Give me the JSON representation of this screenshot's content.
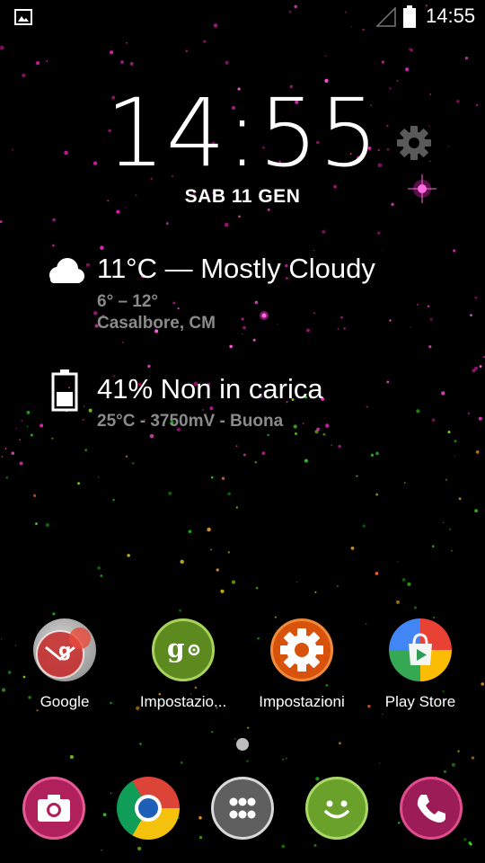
{
  "status_bar": {
    "time": "14:55",
    "icons": [
      "image-icon",
      "signal-icon",
      "battery-icon"
    ]
  },
  "lockscreen": {
    "clock": "14:55",
    "date": "SAB 11 GEN",
    "settings_icon": "gear-icon"
  },
  "weather": {
    "icon": "cloud-icon",
    "summary": "11°C — Mostly Cloudy",
    "range": "6° – 12°",
    "location": "Casalbore, CM"
  },
  "battery_widget": {
    "icon": "battery-icon",
    "status": "41% Non in carica",
    "details": "25°C - 3750mV - Buona"
  },
  "apps": [
    {
      "label": "Google",
      "icon": "google-folder-icon"
    },
    {
      "label": "Impostazio...",
      "icon": "google-settings-icon"
    },
    {
      "label": "Impostazioni",
      "icon": "settings-gear-icon"
    },
    {
      "label": "Play Store",
      "icon": "play-store-icon"
    }
  ],
  "dock": [
    {
      "icon": "camera-icon"
    },
    {
      "icon": "chrome-icon"
    },
    {
      "icon": "app-drawer-icon"
    },
    {
      "icon": "messaging-icon"
    },
    {
      "icon": "phone-icon"
    }
  ],
  "colors": {
    "background": "#000000",
    "secondary_text": "#8a8a8a",
    "camera": "#b0205a",
    "settings_orange": "#d8520c",
    "google_settings_green": "#5c8a1e",
    "messaging_green": "#6aa12a",
    "phone": "#9c1c58"
  }
}
